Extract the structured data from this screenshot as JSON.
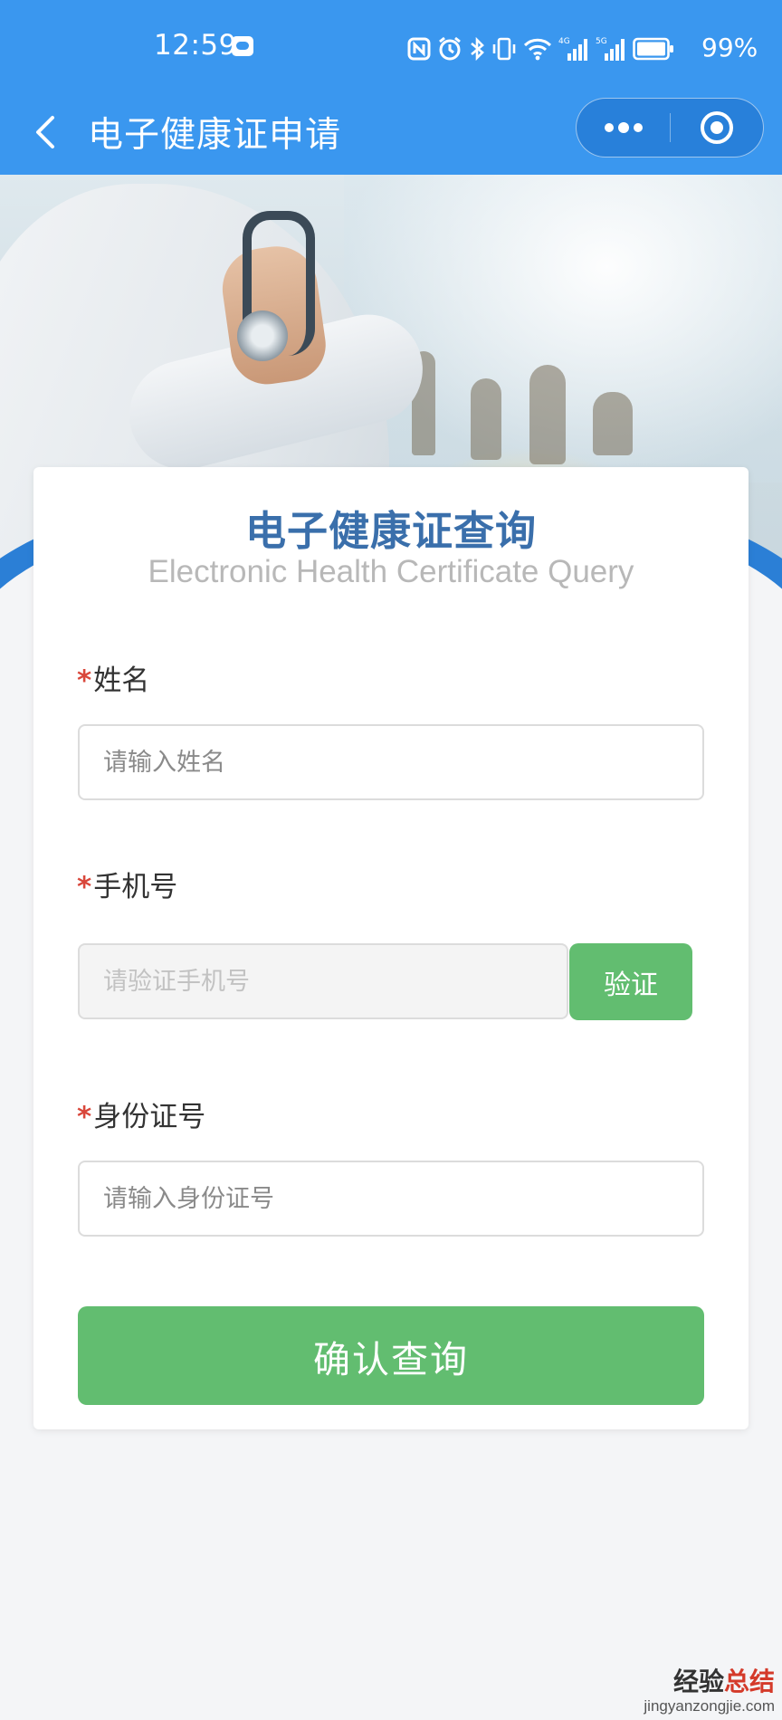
{
  "status_bar": {
    "time": "12:59",
    "battery_percent": "99%",
    "icons": [
      "weather-icon",
      "nfc-icon",
      "alarm-icon",
      "bluetooth-icon",
      "vibrate-icon",
      "wifi-icon",
      "signal-4g-icon",
      "signal-5g-icon",
      "battery-icon"
    ],
    "network_labels": [
      "4G",
      "5G"
    ]
  },
  "navbar": {
    "title": "电子健康证申请",
    "back_icon": "chevron-left-icon",
    "more_icon": "more-dots-icon",
    "close_icon": "target-close-icon"
  },
  "card": {
    "title": "电子健康证查询",
    "subtitle": "Electronic Health Certificate Query"
  },
  "form": {
    "required_mark": "*",
    "name": {
      "label": "姓名",
      "placeholder": "请输入姓名",
      "value": ""
    },
    "phone": {
      "label": "手机号",
      "placeholder": "请验证手机号",
      "value": "",
      "verify_label": "验证"
    },
    "id_number": {
      "label": "身份证号",
      "placeholder": "请输入身份证号",
      "value": ""
    },
    "submit_label": "确认查询"
  },
  "watermark": {
    "main_prefix": "经验",
    "main_accent": "总结",
    "sub": "jingyanzongjie.com"
  },
  "colors": {
    "header_blue": "#3a97ef",
    "title_blue": "#3a6fab",
    "button_green": "#62bd70",
    "required_red": "#d9473b",
    "page_background": "#f4f5f7"
  }
}
